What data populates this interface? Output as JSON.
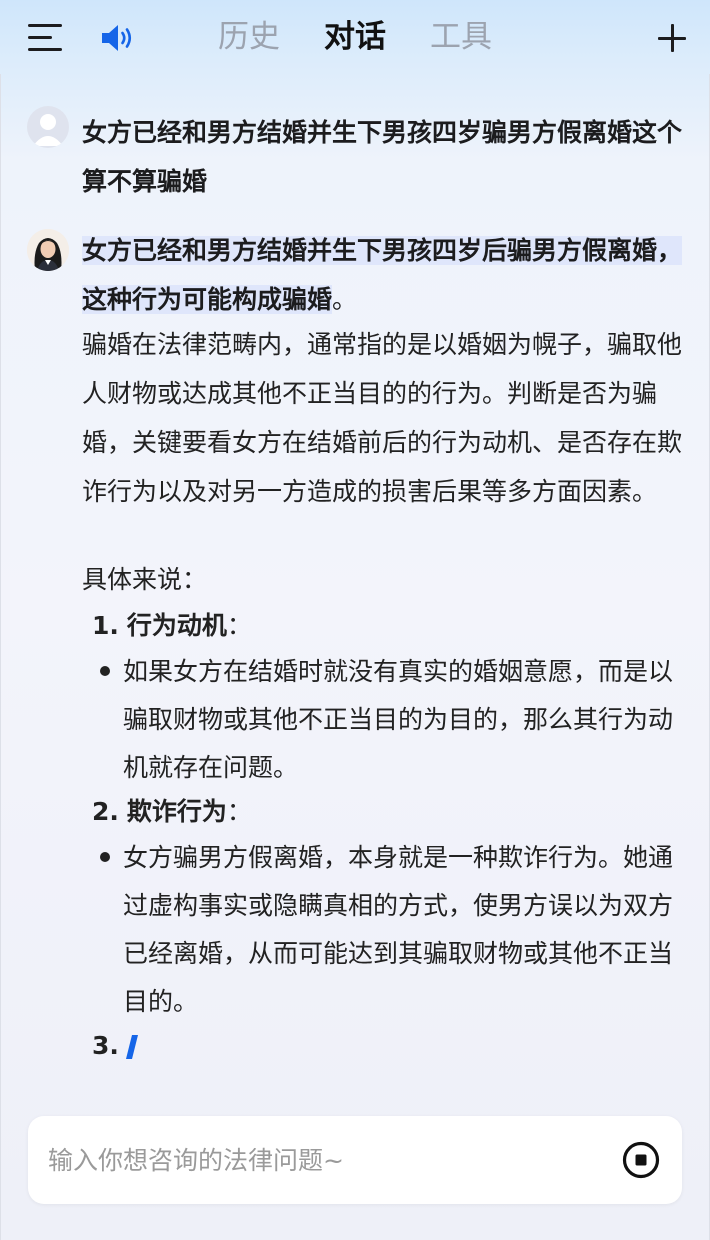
{
  "header": {
    "tabs": [
      {
        "label": "历史",
        "active": false
      },
      {
        "label": "对话",
        "active": true
      },
      {
        "label": "工具",
        "active": false
      }
    ],
    "icons": {
      "menu": "menu-icon",
      "speaker": "speaker-icon",
      "new_chat": "plus-icon"
    }
  },
  "conversation": {
    "user_message": "女方已经和男方结婚并生下男孩四岁骗男方假离婚这个算不算骗婚",
    "bot_reply": {
      "title_highlight": "女方已经和男方结婚并生下男孩四岁后骗男方假离婚，这种行为可能构成骗婚",
      "title_tail": "。",
      "paragraph": "骗婚在法律范畴内，通常指的是以婚姻为幌子，骗取他人财物或达成其他不正当目的的行为。判断是否为骗婚，关键要看女方在结婚前后的行为动机、是否存在欺诈行为以及对另一方造成的损害后果等多方面因素。",
      "lead": "具体来说：",
      "items": [
        {
          "number": "1.",
          "heading": "行为动机",
          "colon": "：",
          "bullet": "如果女方在结婚时就没有真实的婚姻意愿，而是以骗取财物或其他不正当目的为目的，那么其行为动机就存在问题。"
        },
        {
          "number": "2.",
          "heading": "欺诈行为",
          "colon": "：",
          "bullet": "女方骗男方假离婚，本身就是一种欺诈行为。她通过虚构事实或隐瞒真相的方式，使男方误以为双方已经离婚，从而可能达到其骗取财物或其他不正当目的。"
        },
        {
          "number": "3."
        }
      ]
    }
  },
  "composer": {
    "placeholder": "输入你想咨询的法律问题~",
    "value": "",
    "stop_icon": "stop-icon"
  },
  "colors": {
    "accent": "#1565e8",
    "highlight": "#dfe6fb",
    "muted_tab": "#9ca3af"
  }
}
